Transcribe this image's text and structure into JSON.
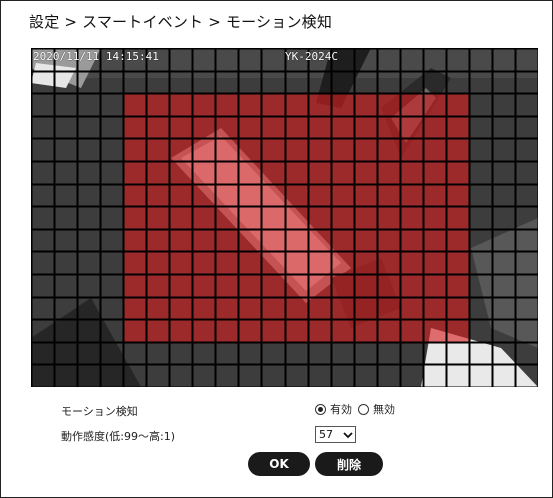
{
  "breadcrumb": "設定 > スマートイベント > モーション検知",
  "camera": {
    "timestamp": "2020/11/11 14:15:41",
    "camera_name": "YK-2024C",
    "grid": {
      "cols": 22,
      "rows": 15
    },
    "detection_area": {
      "col_start": 4,
      "col_end": 19,
      "row_start": 2,
      "row_end": 13
    },
    "detection_color": "#d81e1e"
  },
  "motion_detection": {
    "label": "モーション検知",
    "options": [
      {
        "label": "有効",
        "checked": true
      },
      {
        "label": "無効",
        "checked": false
      }
    ]
  },
  "sensitivity": {
    "label": "動作感度(低:99～高:1)",
    "value": "57"
  },
  "buttons": {
    "ok": "OK",
    "delete": "削除"
  }
}
